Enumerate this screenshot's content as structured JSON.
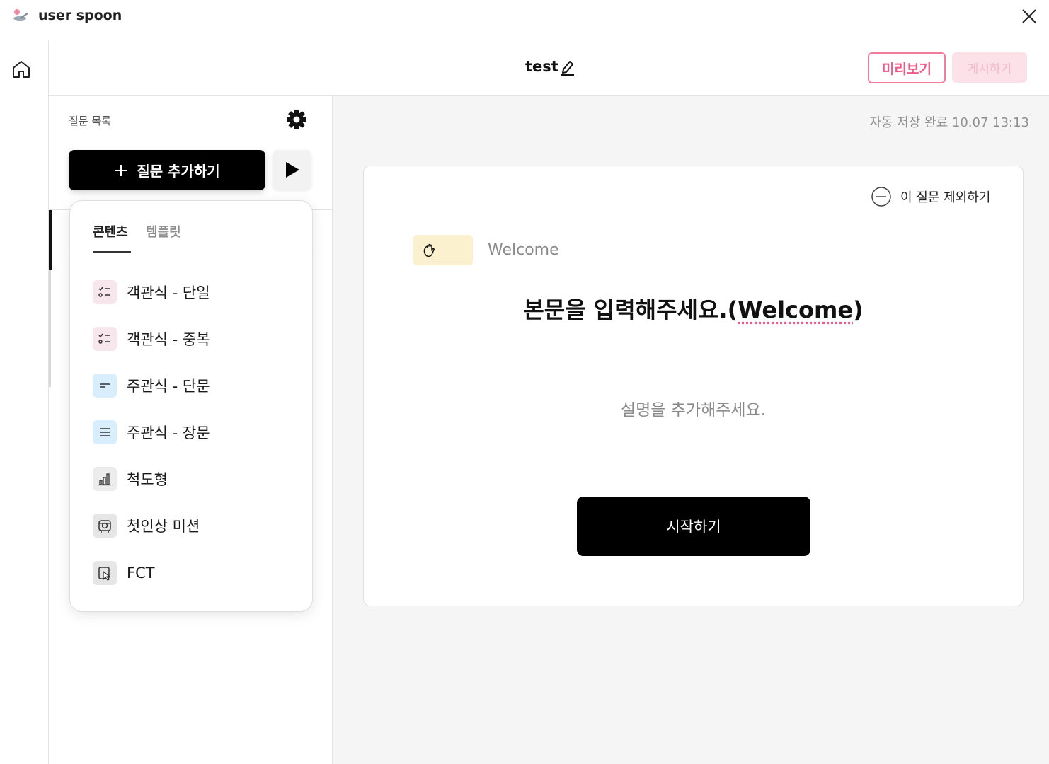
{
  "app": {
    "title": "user spoon"
  },
  "topbar": {
    "doc_title": "test",
    "preview_label": "미리보기",
    "publish_label": "게시하기"
  },
  "sidepanel": {
    "list_label": "질문 목록",
    "add_label": "질문 추가하기"
  },
  "dropdown": {
    "tabs": [
      {
        "label": "콘텐츠",
        "active": true
      },
      {
        "label": "템플릿",
        "active": false
      }
    ],
    "items": [
      {
        "label": "객관식 - 단일",
        "icon": "single-choice-icon",
        "color": "#f7e6ec"
      },
      {
        "label": "객관식 - 중복",
        "icon": "multi-choice-icon",
        "color": "#f7e6ec"
      },
      {
        "label": "주관식 - 단문",
        "icon": "short-text-icon",
        "color": "#d9eefc"
      },
      {
        "label": "주관식 - 장문",
        "icon": "long-text-icon",
        "color": "#d9eefc"
      },
      {
        "label": "척도형",
        "icon": "bar-chart-icon",
        "color": "#ececec"
      },
      {
        "label": "첫인상 미션",
        "icon": "first-impression-icon",
        "color": "#e6e6e6"
      },
      {
        "label": "FCT",
        "icon": "cursor-click-icon",
        "color": "#e6e6e6"
      }
    ]
  },
  "main": {
    "autosave": "자동 저장 완료 10.07 13:13",
    "exclude_label": "이 질문 제외하기",
    "badge_label": "Welcome",
    "title_prefix": "본문을 입력해주세요.(",
    "title_word": "Welcome",
    "title_suffix": ")",
    "description": "설명을 추가해주세요.",
    "start_label": "시작하기"
  },
  "colors": {
    "accent_pink": "#ee5b86",
    "publish_disabled": "#fde1e9",
    "badge_yellow": "#fbf1cf"
  }
}
